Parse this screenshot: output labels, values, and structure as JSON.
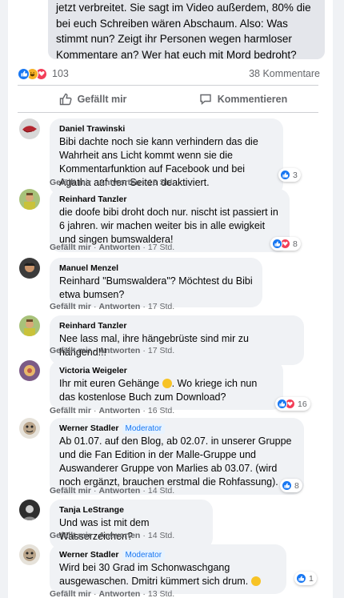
{
  "post": {
    "text": "jetzt verbreitet. Sie sagt im Video außerdem, 80% die bei euch Schreiben wären Abschaum. Also: Was stimmt nun? Zeigt ihr Personen wegen harmloser Kommentare an? Wer hat euch mit Mord bedroht? Mfg und Danke für eine Antwort",
    "reactions_count": "103",
    "comments_count": "38 Kommentare",
    "reaction_icons": [
      "like",
      "haha",
      "love"
    ]
  },
  "actions": {
    "like_label": "Gefällt mir",
    "comment_label": "Kommentieren"
  },
  "meta_labels": {
    "like": "Gefällt mir",
    "reply": "Antworten"
  },
  "comments": [
    {
      "author": "Daniel Trawinski",
      "badge": "",
      "text": "Bibi dachte noch sie kann verhindern das die Wahrheit ans Licht kommt wenn sie die Kommentarfunktion auf Facebook und bei Agatha auf den Seiten deaktiviert.",
      "time": "18 Std.",
      "reaction_count": "3",
      "reaction_types": [
        "like"
      ]
    },
    {
      "author": "Reinhard Tanzler",
      "badge": "",
      "text": "die doofe bibi droht doch nur. nischt ist passiert in 6 jahren. wir machen weiter bis in alle ewigkeit und singen bumswaldera!",
      "time": "17 Std.",
      "reaction_count": "8",
      "reaction_types": [
        "like",
        "love"
      ]
    },
    {
      "author": "Manuel Menzel",
      "badge": "",
      "text": "Reinhard \"Bumswaldera\"? Möchtest du Bibi etwa bumsen?",
      "time": "17 Std.",
      "reaction_count": "",
      "reaction_types": []
    },
    {
      "author": "Reinhard Tanzler",
      "badge": "",
      "text": "Nee lass mal, ihre hängebrüste sind mir zu hängend!!!",
      "time": "17 Std.",
      "reaction_count": "",
      "reaction_types": []
    },
    {
      "author": "Victoria Weigeler",
      "badge": "",
      "text_before_emoji": "Ihr mit euren Gehänge",
      "text_after_emoji": ". Wo kriege ich nun das kostenlose Buch zum Download?",
      "time": "16 Std.",
      "reaction_count": "16",
      "reaction_types": [
        "like",
        "love"
      ]
    },
    {
      "author": "Werner Stadler",
      "badge": "Moderator",
      "text": "Ab 01.07. auf den Blog, ab 02.07. in unserer Gruppe und die Fan Edition in der Malle-Gruppe und Auswanderer Gruppe von Marlies ab 03.07. (wird noch ergänzt, brauchen erstmal die Rohfassung).",
      "time": "14 Std.",
      "reaction_count": "8",
      "reaction_types": [
        "like"
      ]
    },
    {
      "author": "Tanja LeStrange",
      "badge": "",
      "text": "Und was ist mit dem Wasserzeichen?",
      "time": "14 Std.",
      "reaction_count": "",
      "reaction_types": []
    },
    {
      "author": "Werner Stadler",
      "badge": "Moderator",
      "text_before_emoji": "Wird bei 30 Grad im Schonwaschgang ausgewaschen. Dmitri kümmert sich drum.",
      "text_after_emoji": "",
      "time": "13 Std.",
      "reaction_count": "1",
      "reaction_types": [
        "like"
      ]
    }
  ],
  "colors": {
    "accent": "#1877f2",
    "love": "#f33e58",
    "haha": "#f7b125",
    "bubble": "#f0f2f5",
    "muted_text": "#65676b"
  }
}
